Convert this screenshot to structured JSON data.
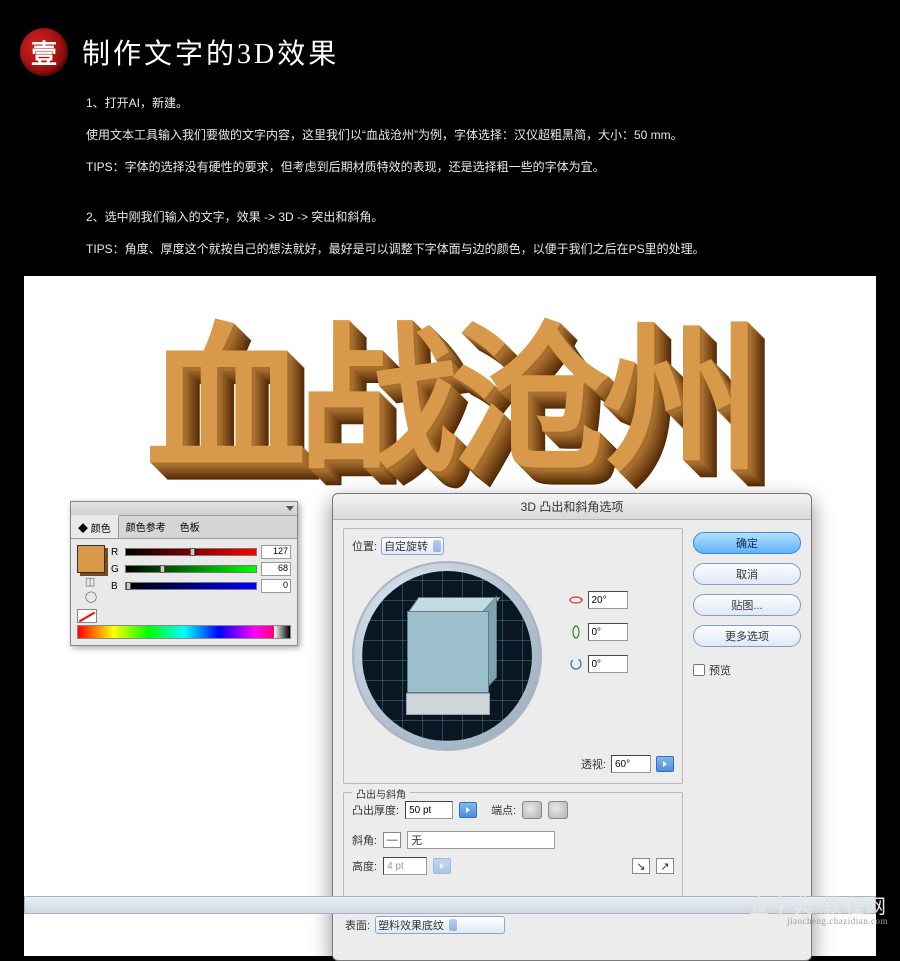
{
  "header": {
    "seal": "壹",
    "title": "制作文字的3D效果"
  },
  "instructions": {
    "line1": "1、打开AI，新建。",
    "line2": "使用文本工具输入我们要做的文字内容，这里我们以“血战沧州”为例，字体选择：汉仪超粗黑简，大小：50 mm。",
    "line3": "TIPS：字体的选择没有硬性的要求，但考虑到后期材质特效的表现，还是选择粗一些的字体为宜。",
    "line4": "2、选中刚我们输入的文字，效果 -> 3D -> 突出和斜角。",
    "line5": "TIPS：角度、厚度这个就按自己的想法就好，最好是可以调整下字体面与边的颜色，以便于我们之后在PS里的处理。"
  },
  "artwork_text": "血战沧州",
  "color_panel": {
    "tabs": [
      "颜色",
      "颜色参考",
      "色板"
    ],
    "channels": [
      {
        "label": "R",
        "value": "127",
        "pct": 50
      },
      {
        "label": "G",
        "value": "68",
        "pct": 27
      },
      {
        "label": "B",
        "value": "0",
        "pct": 0
      }
    ]
  },
  "dialog": {
    "title": "3D 凸出和斜角选项",
    "position_group": "位置:",
    "position_value": "自定旋转",
    "angles": {
      "x": "20°",
      "y": "0°",
      "z": "0°"
    },
    "perspective_label": "透视:",
    "perspective_value": "60°",
    "extrude_group": "凸出与斜角",
    "extrude_label": "凸出厚度:",
    "extrude_value": "50 pt",
    "endcap_label": "端点:",
    "bevel_label": "斜角:",
    "bevel_value": "无",
    "height_label": "高度:",
    "height_value": "4 pt",
    "surface_label": "表面:",
    "surface_value": "塑料效果底纹",
    "buttons": {
      "ok": "确定",
      "cancel": "取消",
      "map": "贴图...",
      "more": "更多选项"
    },
    "preview_label": "预览"
  },
  "watermark": {
    "brand": "查字典 教程网",
    "url": "jiaocheng.chazidian.com"
  }
}
